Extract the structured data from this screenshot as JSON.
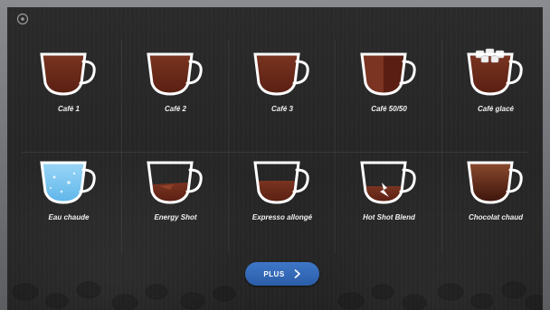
{
  "menu": {
    "items": [
      {
        "label": "Café 1",
        "fill": "coffee"
      },
      {
        "label": "Café 2",
        "fill": "coffee"
      },
      {
        "label": "Café 3",
        "fill": "coffee"
      },
      {
        "label": "Café 50/50",
        "fill": "half"
      },
      {
        "label": "Café glacé",
        "fill": "iced"
      },
      {
        "label": "Eau chaude",
        "fill": "water"
      },
      {
        "label": "Energy Shot",
        "fill": "shot"
      },
      {
        "label": "Expresso allongé",
        "fill": "allonge"
      },
      {
        "label": "Hot Shot Blend",
        "fill": "blend"
      },
      {
        "label": "Chocolat chaud",
        "fill": "chocolate"
      }
    ]
  },
  "actions": {
    "plus_label": "PLUS"
  },
  "icons": {
    "top_left": "settings-icon",
    "plus": "chevron-right-icon",
    "cup": "cup-icon"
  },
  "colors": {
    "accent": "#2f66b4",
    "coffee": "#5a1f12",
    "water": "#5fb6ea"
  }
}
